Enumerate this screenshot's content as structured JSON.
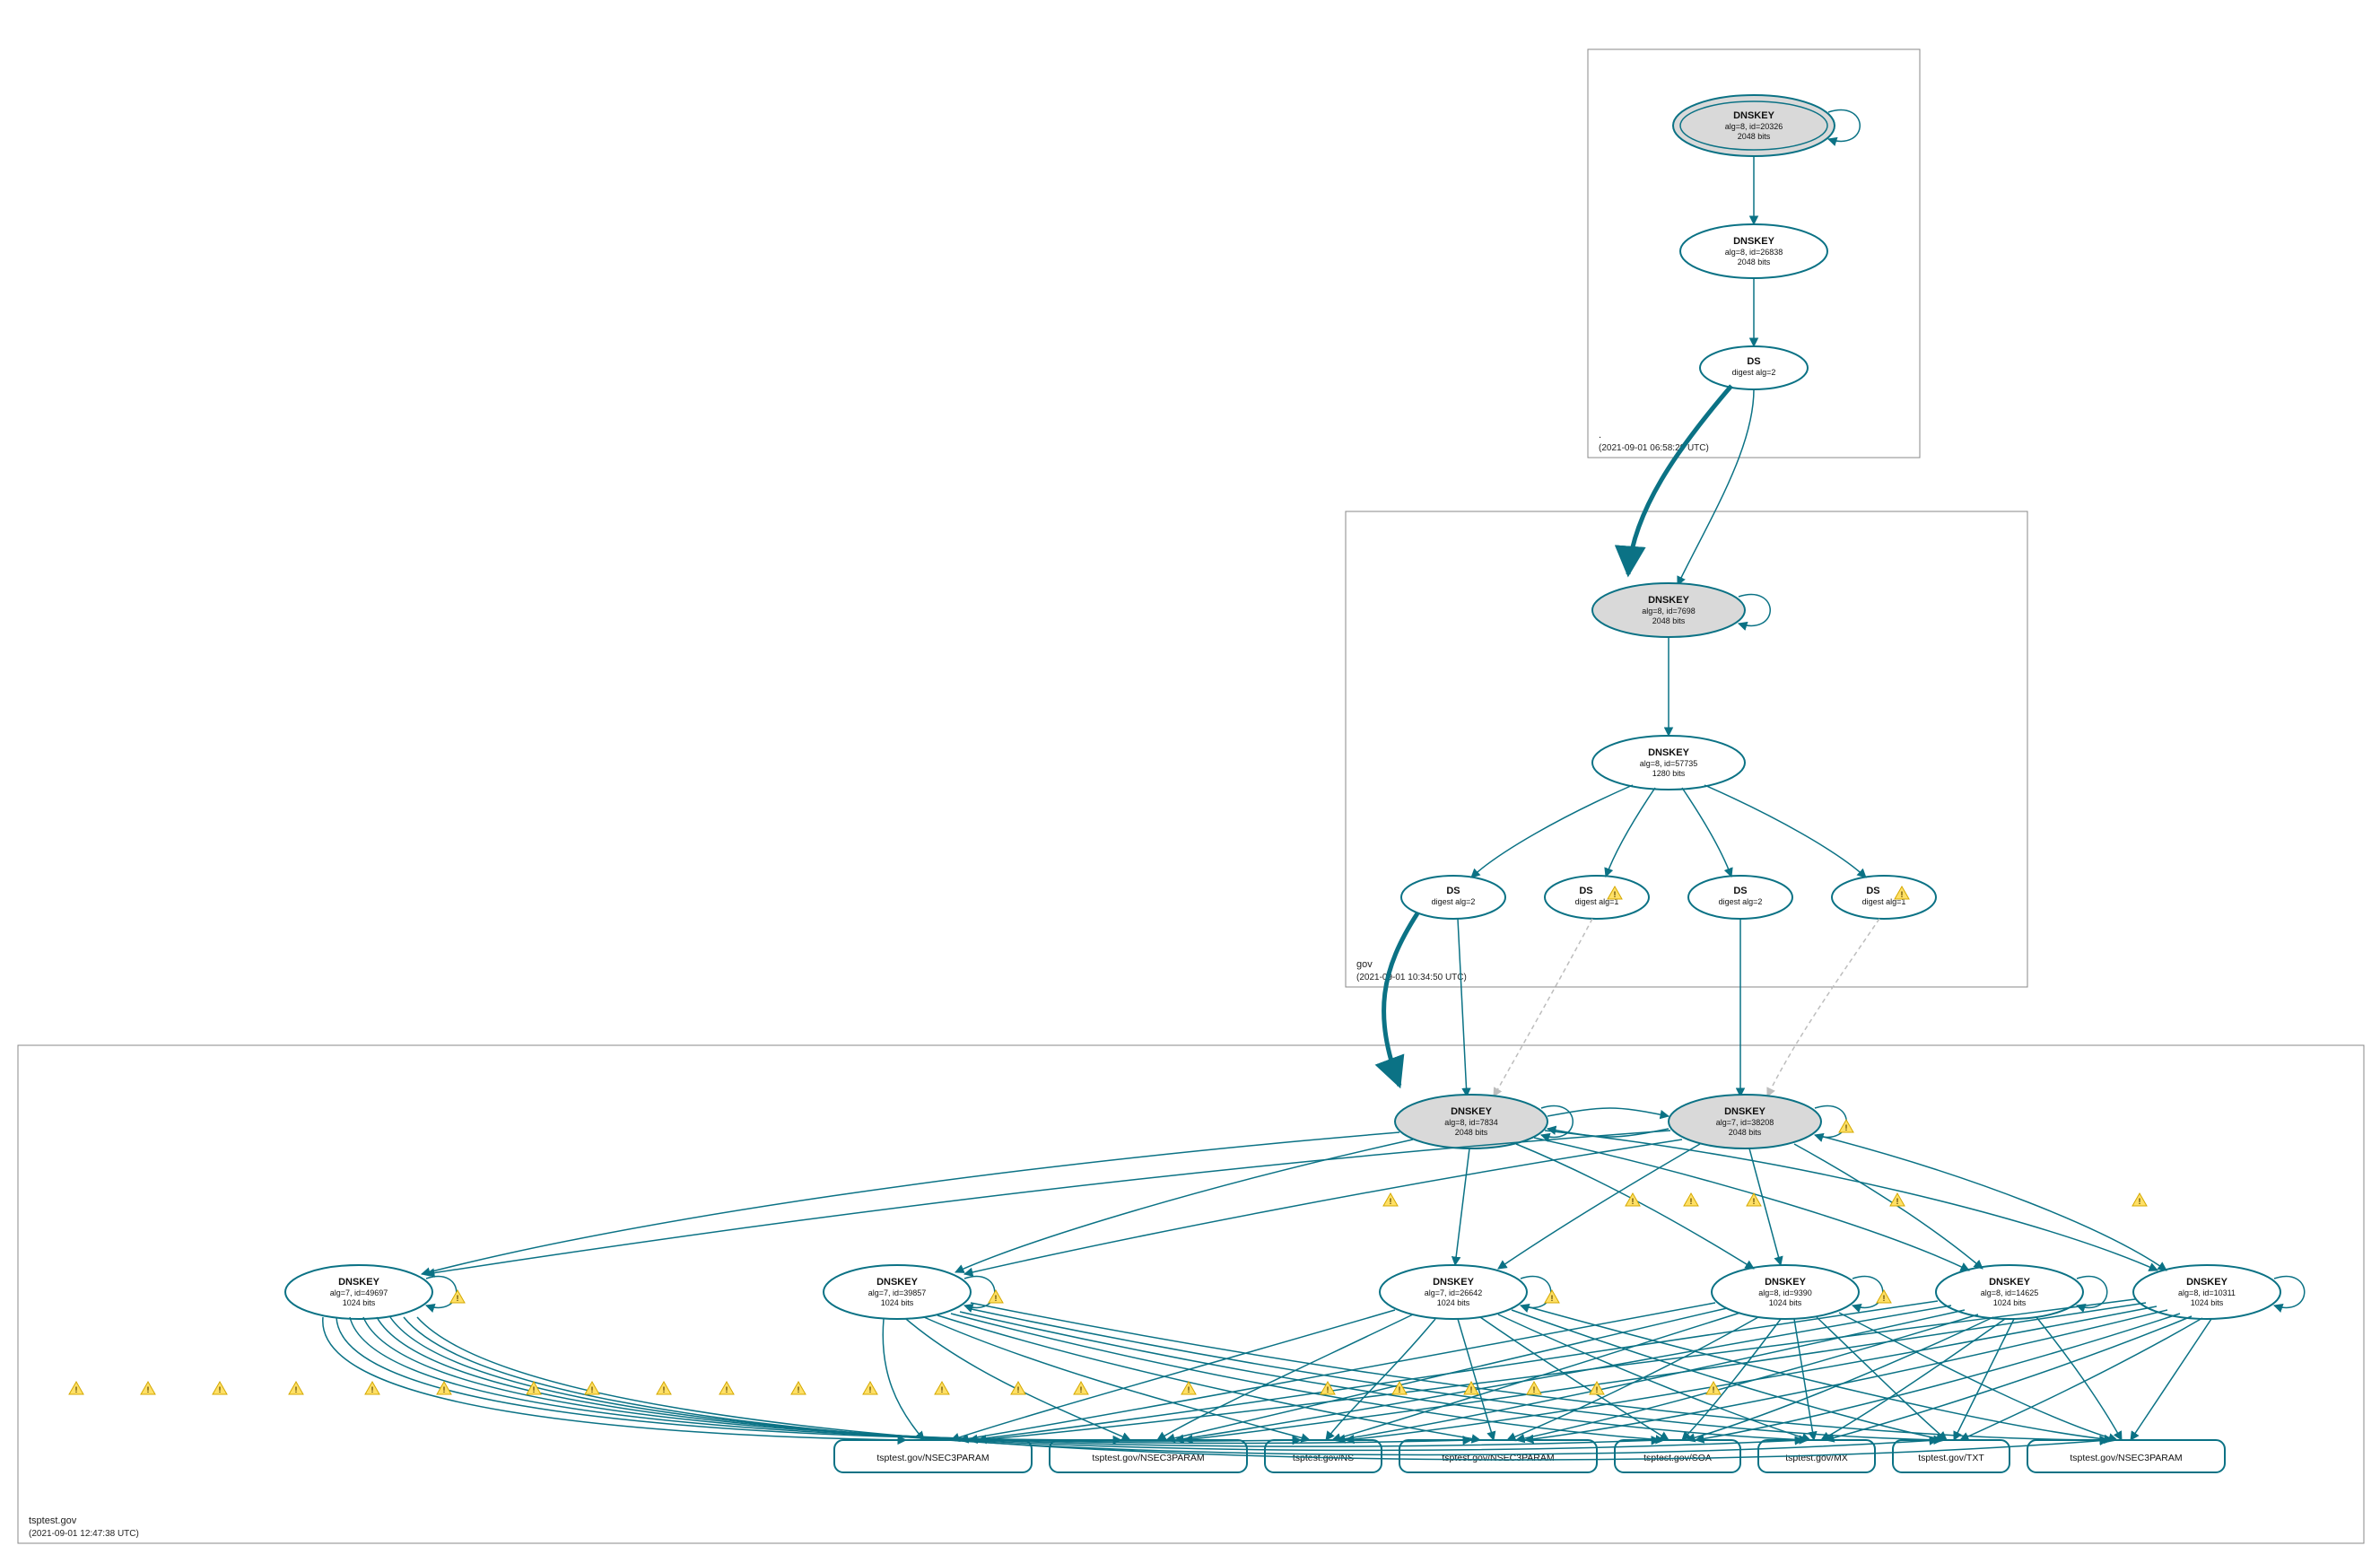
{
  "colors": {
    "stroke": "#0b7285",
    "ksk_fill": "#d9d9d9",
    "warn_fill": "#ffe066",
    "warn_stroke": "#d4a800",
    "dashed": "#bdbdbd"
  },
  "zones": {
    "root": {
      "name": ".",
      "timestamp": "(2021-09-01 06:58:29 UTC)"
    },
    "gov": {
      "name": "gov",
      "timestamp": "(2021-09-01 10:34:50 UTC)"
    },
    "tsptest": {
      "name": "tsptest.gov",
      "timestamp": "(2021-09-01 12:47:38 UTC)"
    }
  },
  "nodes": {
    "root_ksk": {
      "title": "DNSKEY",
      "l1": "alg=8, id=20326",
      "l2": "2048 bits"
    },
    "root_zsk": {
      "title": "DNSKEY",
      "l1": "alg=8, id=26838",
      "l2": "2048 bits"
    },
    "root_ds": {
      "title": "DS",
      "l1": "digest alg=2",
      "l2": ""
    },
    "gov_ksk": {
      "title": "DNSKEY",
      "l1": "alg=8, id=7698",
      "l2": "2048 bits"
    },
    "gov_zsk": {
      "title": "DNSKEY",
      "l1": "alg=8, id=57735",
      "l2": "1280 bits"
    },
    "gov_ds1": {
      "title": "DS",
      "l1": "digest alg=2",
      "l2": ""
    },
    "gov_ds2": {
      "title": "DS",
      "l1": "digest alg=1",
      "l2": ""
    },
    "gov_ds3": {
      "title": "DS",
      "l1": "digest alg=2",
      "l2": ""
    },
    "gov_ds4": {
      "title": "DS",
      "l1": "digest alg=1",
      "l2": ""
    },
    "t_ksk_a": {
      "title": "DNSKEY",
      "l1": "alg=8, id=7834",
      "l2": "2048 bits"
    },
    "t_ksk_b": {
      "title": "DNSKEY",
      "l1": "alg=7, id=38208",
      "l2": "2048 bits"
    },
    "t_zsk_1": {
      "title": "DNSKEY",
      "l1": "alg=7, id=49697",
      "l2": "1024 bits"
    },
    "t_zsk_2": {
      "title": "DNSKEY",
      "l1": "alg=7, id=39857",
      "l2": "1024 bits"
    },
    "t_zsk_3": {
      "title": "DNSKEY",
      "l1": "alg=7, id=26642",
      "l2": "1024 bits"
    },
    "t_zsk_4": {
      "title": "DNSKEY",
      "l1": "alg=8, id=9390",
      "l2": "1024 bits"
    },
    "t_zsk_5": {
      "title": "DNSKEY",
      "l1": "alg=8, id=14625",
      "l2": "1024 bits"
    },
    "t_zsk_6": {
      "title": "DNSKEY",
      "l1": "alg=8, id=10311",
      "l2": "1024 bits"
    }
  },
  "rrsets": {
    "rr1": "tsptest.gov/NSEC3PARAM",
    "rr2": "tsptest.gov/NSEC3PARAM",
    "rr3": "tsptest.gov/NS",
    "rr4": "tsptest.gov/NSEC3PARAM",
    "rr5": "tsptest.gov/SOA",
    "rr6": "tsptest.gov/MX",
    "rr7": "tsptest.gov/TXT",
    "rr8": "tsptest.gov/NSEC3PARAM"
  }
}
